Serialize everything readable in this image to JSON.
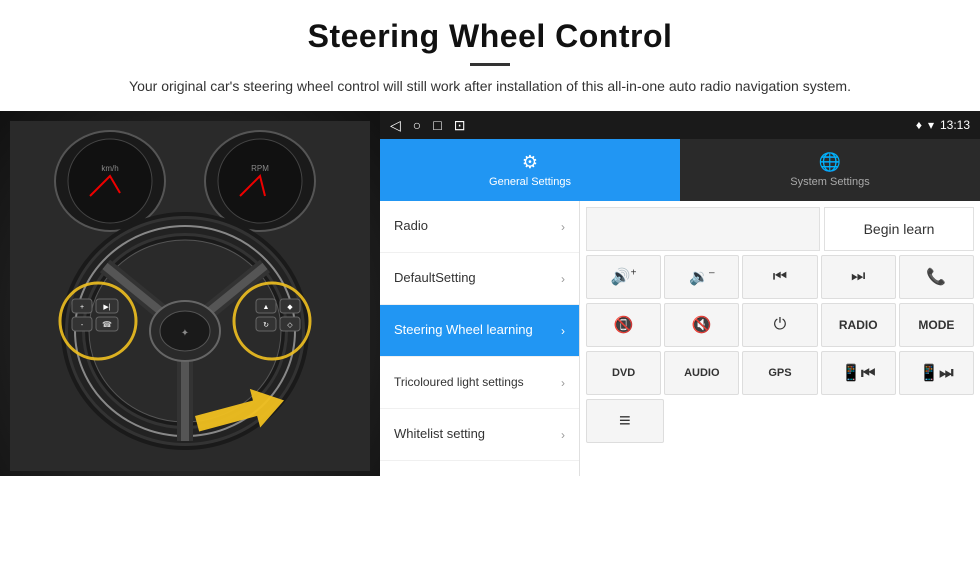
{
  "header": {
    "title": "Steering Wheel Control",
    "subtitle": "Your original car's steering wheel control will still work after installation of this all-in-one auto radio navigation system.",
    "divider": true
  },
  "status_bar": {
    "time": "13:13",
    "nav_icons": [
      "◁",
      "○",
      "□",
      "⊡"
    ],
    "right_icons": [
      "♥",
      "▾"
    ]
  },
  "tabs": [
    {
      "id": "general",
      "label": "General Settings",
      "icon": "⚙",
      "active": true
    },
    {
      "id": "system",
      "label": "System Settings",
      "icon": "🌐",
      "active": false
    }
  ],
  "menu": {
    "items": [
      {
        "id": "radio",
        "label": "Radio",
        "active": false
      },
      {
        "id": "default-setting",
        "label": "DefaultSetting",
        "active": false
      },
      {
        "id": "steering-wheel",
        "label": "Steering Wheel learning",
        "active": true
      },
      {
        "id": "tricoloured",
        "label": "Tricoloured light settings",
        "active": false
      },
      {
        "id": "whitelist",
        "label": "Whitelist setting",
        "active": false
      }
    ]
  },
  "controls": {
    "begin_learn_label": "Begin learn",
    "row1": [
      {
        "id": "vol-up",
        "icon": "🔊+",
        "type": "icon"
      },
      {
        "id": "vol-down",
        "icon": "🔉-",
        "type": "icon"
      },
      {
        "id": "prev-track",
        "icon": "⏮",
        "type": "icon"
      },
      {
        "id": "next-track",
        "icon": "⏭",
        "type": "icon"
      },
      {
        "id": "phone",
        "icon": "📞",
        "type": "icon"
      }
    ],
    "row2": [
      {
        "id": "hang-up",
        "icon": "📵",
        "type": "icon"
      },
      {
        "id": "mute",
        "icon": "🔇x",
        "type": "icon"
      },
      {
        "id": "power",
        "icon": "⏻",
        "type": "icon"
      },
      {
        "id": "radio-btn",
        "label": "RADIO",
        "type": "text"
      },
      {
        "id": "mode-btn",
        "label": "MODE",
        "type": "text"
      }
    ],
    "row3": [
      {
        "id": "dvd-btn",
        "label": "DVD",
        "type": "text"
      },
      {
        "id": "audio-btn",
        "label": "AUDIO",
        "type": "text"
      },
      {
        "id": "gps-btn",
        "label": "GPS",
        "type": "text"
      },
      {
        "id": "tel-prev",
        "icon": "📱⏮",
        "type": "icon"
      },
      {
        "id": "tel-next",
        "icon": "📱⏭",
        "type": "icon"
      }
    ],
    "row4": [
      {
        "id": "list-icon",
        "icon": "≡",
        "type": "icon"
      }
    ]
  }
}
